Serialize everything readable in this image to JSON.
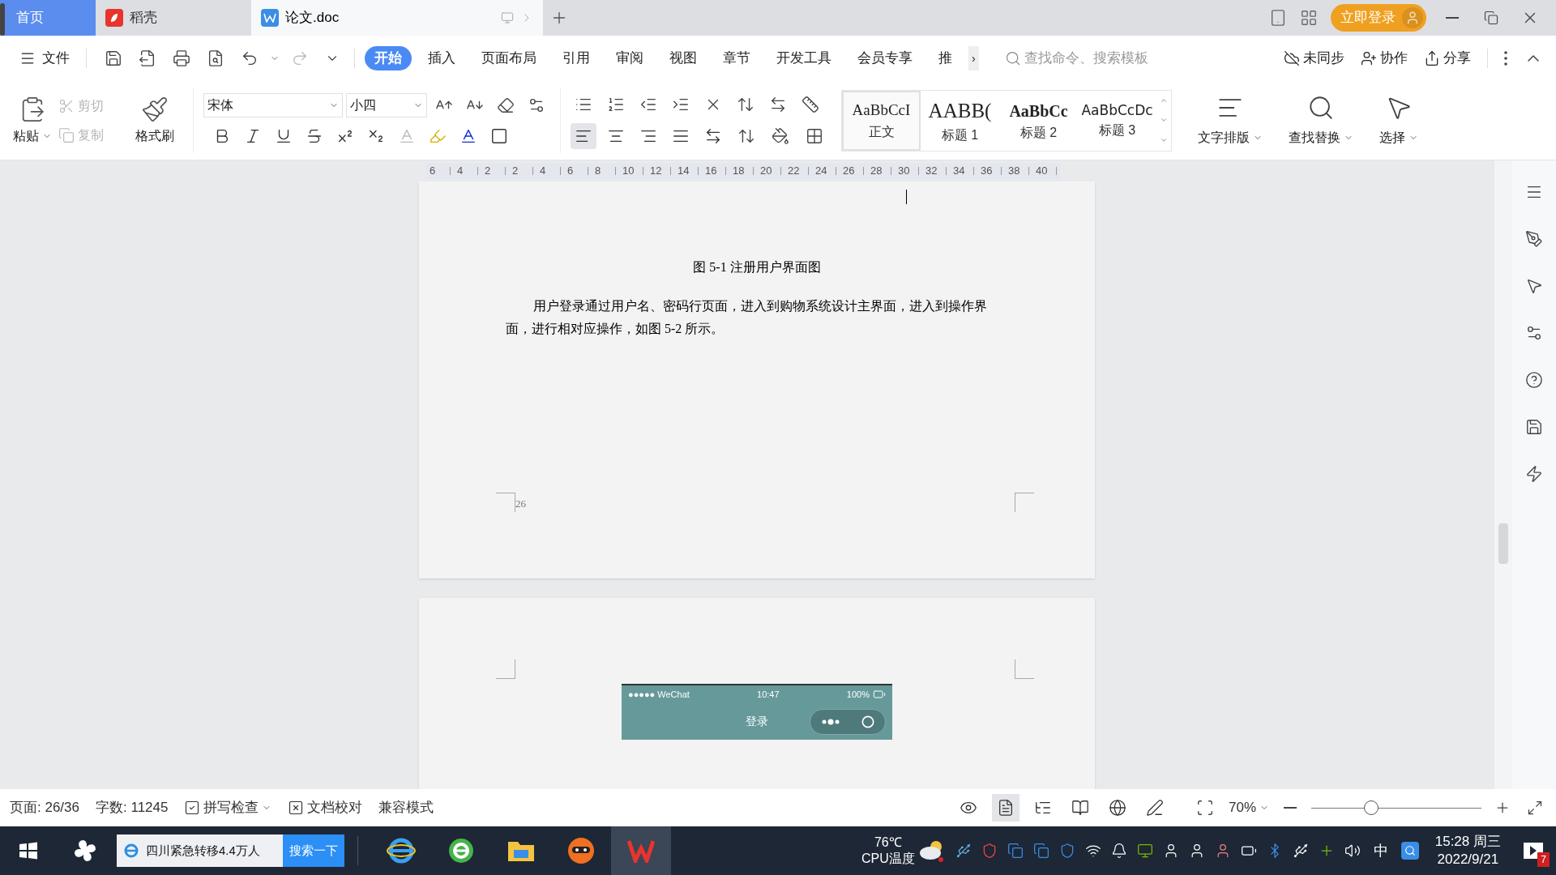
{
  "tabs": [
    {
      "label": "首页",
      "kind": "home",
      "selected": false
    },
    {
      "label": "稻壳",
      "kind": "docer",
      "selected": false
    },
    {
      "label": "论文.doc",
      "kind": "doc",
      "selected": true
    }
  ],
  "login_button": "立即登录",
  "menu": {
    "file": "文件",
    "tabs": [
      {
        "label": "开始",
        "selected": true
      },
      {
        "label": "插入",
        "selected": false
      },
      {
        "label": "页面布局",
        "selected": false
      },
      {
        "label": "引用",
        "selected": false
      },
      {
        "label": "审阅",
        "selected": false
      },
      {
        "label": "视图",
        "selected": false
      },
      {
        "label": "章节",
        "selected": false
      },
      {
        "label": "开发工具",
        "selected": false
      },
      {
        "label": "会员专享",
        "selected": false
      },
      {
        "label": "推",
        "selected": false
      }
    ],
    "more": "›",
    "search": {
      "placeholder": "查找命令、搜索模板"
    },
    "actions": [
      "未同步",
      "协作",
      "分享"
    ]
  },
  "ribbon": {
    "paste": "粘贴",
    "clipboard": [
      {
        "label": "剪切",
        "disabled": true
      },
      {
        "label": "复制",
        "disabled": true
      }
    ],
    "format_painter": "格式刷",
    "font": "宋体",
    "size": "小四",
    "alignment": [
      {
        "kind": "left",
        "selected": true
      },
      {
        "kind": "center",
        "selected": false
      },
      {
        "kind": "right",
        "selected": false
      },
      {
        "kind": "justify",
        "selected": false
      },
      {
        "kind": "distribute",
        "selected": false
      }
    ],
    "styles": [
      {
        "sample": "AaBbCcI",
        "label": "正文",
        "selected": true
      },
      {
        "sample": "AABB(",
        "label": "标题 1",
        "selected": false
      },
      {
        "sample": "AaBbCc",
        "label": "标题 2",
        "selected": false
      },
      {
        "sample": "AaBbCcDc",
        "label": "标题 3",
        "selected": false
      }
    ],
    "tools": [
      "文字排版",
      "查找替换",
      "选择"
    ]
  },
  "ruler": {
    "labels": [
      "6",
      "4",
      "2",
      "2",
      "4",
      "6",
      "8",
      "10",
      "12",
      "14",
      "16",
      "18",
      "20",
      "22",
      "24",
      "26",
      "28",
      "30",
      "32",
      "34",
      "36",
      "38",
      "40"
    ]
  },
  "document": {
    "caption": "图 5-1 注册用户界面图",
    "paragraph": "用户登录通过用户名、密码行页面，进入到购物系统设计主界面，进入到操作界面，进行相对应操作，如图 5-2 所示。",
    "page_number": "26",
    "screenshot": {
      "carrier": "●●●●● WeChat",
      "time": "10:47",
      "battery": "100%",
      "title": "登录"
    }
  },
  "status_bar": {
    "page": "页面: 26/36",
    "words": "字数: 11245",
    "spell_check": "拼写检查",
    "proofread": "文档校对",
    "compat": "兼容模式",
    "views": [
      {
        "kind": "read",
        "selected": false
      },
      {
        "kind": "page",
        "selected": true
      },
      {
        "kind": "outline",
        "selected": false
      },
      {
        "kind": "book",
        "selected": false
      },
      {
        "kind": "web",
        "selected": false
      },
      {
        "kind": "write",
        "selected": false
      }
    ],
    "zoom": "70%",
    "zoom_slider": {
      "level": 0.35
    }
  },
  "taskbar": {
    "search_text": "四川紧急转移4.4万人",
    "search_button": "搜索一下",
    "apps": [
      {
        "kind": "ie",
        "selected": false
      },
      {
        "kind": "browser",
        "selected": false
      },
      {
        "kind": "folder",
        "selected": false
      },
      {
        "kind": "mascot",
        "selected": false
      },
      {
        "kind": "wps",
        "selected": true
      }
    ],
    "temperature": "76℃",
    "temperature_label": "CPU温度",
    "ime": "中",
    "time": "15:28 周三",
    "date": "2022/9/21",
    "notification_count": "7"
  }
}
